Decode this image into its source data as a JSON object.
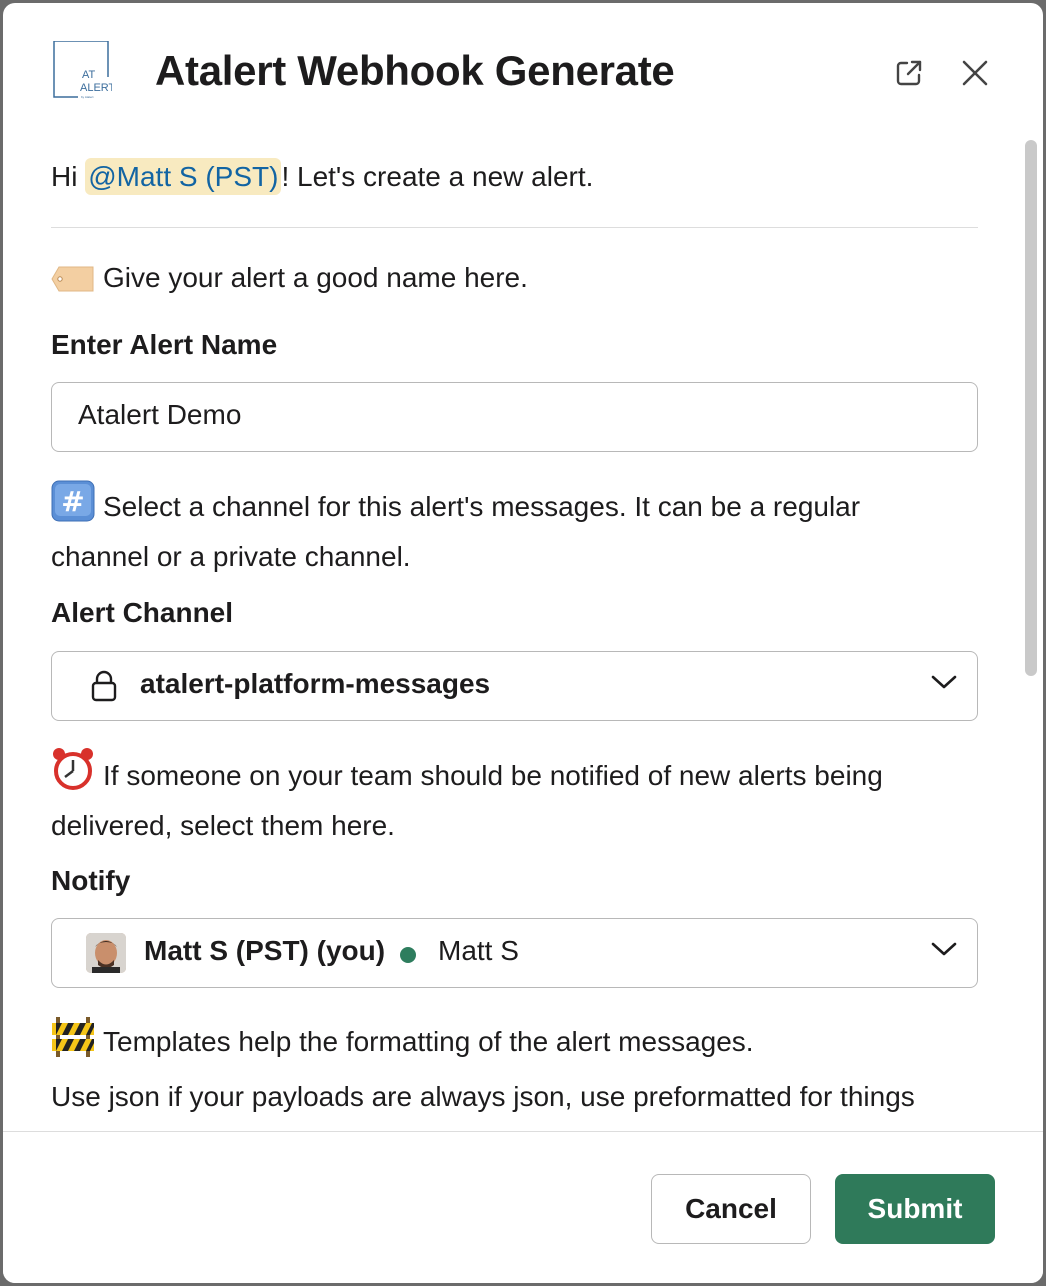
{
  "header": {
    "title": "Atalert Webhook Generate",
    "logo_text_top": "AT",
    "logo_text_bottom": "ALERT",
    "logo_text_small": "by Atalert"
  },
  "intro": {
    "greeting_prefix": "Hi ",
    "mention": "@Matt S (PST)",
    "greeting_suffix": "! Let's create a new alert."
  },
  "name_section": {
    "hint": "Give your alert a good name here.",
    "hint_icon": "label-tag-icon",
    "label": "Enter Alert Name",
    "value": "Atalert Demo"
  },
  "channel_section": {
    "hint_line1": "Select a channel for this alert's messages. It can be a regular",
    "hint_line2": "channel or a private channel.",
    "hint_icon": "hash-keycap-icon",
    "label": "Alert Channel",
    "selected": "atalert-platform-messages",
    "selected_icon": "lock-icon"
  },
  "notify_section": {
    "hint_line1": "If someone on your team should be notified of new alerts being",
    "hint_line2": "delivered, select them here.",
    "hint_icon": "alarm-clock-icon",
    "label": "Notify",
    "selected_name": "Matt S (PST) (you)",
    "selected_display": "Matt S",
    "status_color": "#2e7d5e"
  },
  "template_section": {
    "hint": "Templates help the formatting of the alert messages.",
    "hint_icon": "construction-icon",
    "description": "Use json if your payloads are always json, use preformatted for things"
  },
  "footer": {
    "cancel_label": "Cancel",
    "submit_label": "Submit"
  },
  "colors": {
    "submit_bg": "#2f7a5a",
    "mention_bg": "#f8eac0",
    "mention_text": "#1264a3"
  }
}
